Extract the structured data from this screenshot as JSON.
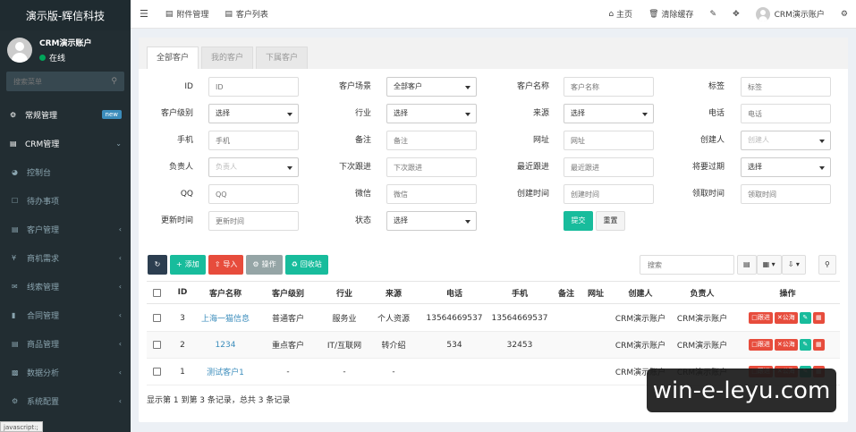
{
  "sidebar": {
    "logo": "演示版-辉信科技",
    "user": {
      "name": "CRM演示账户",
      "status": "在线"
    },
    "search_placeholder": "搜索菜单",
    "items": [
      {
        "label": "常规管理",
        "icon": "cogs-icon",
        "badge": "new"
      },
      {
        "label": "CRM管理",
        "icon": "crm-icon"
      },
      {
        "label": "控制台",
        "icon": "dashboard-icon"
      },
      {
        "label": "待办事项",
        "icon": "todo-icon"
      },
      {
        "label": "客户管理",
        "icon": "customer-icon"
      },
      {
        "label": "商机需求",
        "icon": "yen-icon"
      },
      {
        "label": "线索管理",
        "icon": "clue-icon"
      },
      {
        "label": "合同管理",
        "icon": "bookmark-icon"
      },
      {
        "label": "商品管理",
        "icon": "product-icon"
      },
      {
        "label": "数据分析",
        "icon": "chart-icon"
      },
      {
        "label": "系统配置",
        "icon": "gears-icon"
      }
    ]
  },
  "status_bar": "javascript:;",
  "topnav": {
    "tabs": [
      {
        "label": "附件管理",
        "icon": "file-icon"
      },
      {
        "label": "客户列表",
        "icon": "list-icon"
      }
    ],
    "home": "主页",
    "clear_cache": "清除缓存",
    "user": "CRM演示账户"
  },
  "content": {
    "tabs": [
      "全部客户",
      "我的客户",
      "下属客户"
    ],
    "form": {
      "row1": [
        {
          "label": "ID",
          "placeholder": "ID"
        },
        {
          "label": "客户场景",
          "value": "全部客户"
        },
        {
          "label": "客户名称",
          "placeholder": "客户名称"
        },
        {
          "label": "标签",
          "placeholder": "标签"
        }
      ],
      "row2": [
        {
          "label": "客户级别",
          "value": "选择"
        },
        {
          "label": "行业",
          "value": "选择"
        },
        {
          "label": "来源",
          "value": "选择"
        },
        {
          "label": "电话",
          "placeholder": "电话"
        }
      ],
      "row3": [
        {
          "label": "手机",
          "placeholder": "手机"
        },
        {
          "label": "备注",
          "placeholder": "备注"
        },
        {
          "label": "网址",
          "placeholder": "网址"
        },
        {
          "label": "创建人",
          "value": "创建人"
        }
      ],
      "row4": [
        {
          "label": "负责人",
          "value": "负责人"
        },
        {
          "label": "下次跟进",
          "placeholder": "下次跟进"
        },
        {
          "label": "最近跟进",
          "placeholder": "最近跟进"
        },
        {
          "label": "将要过期",
          "value": "选择"
        }
      ],
      "row5": [
        {
          "label": "QQ",
          "placeholder": "QQ"
        },
        {
          "label": "微信",
          "placeholder": "微信"
        },
        {
          "label": "创建时间",
          "placeholder": "创建时间"
        },
        {
          "label": "领取时间",
          "placeholder": "领取时间"
        }
      ],
      "row6": [
        {
          "label": "更新时间",
          "placeholder": "更新时间"
        },
        {
          "label": "状态",
          "value": "选择"
        }
      ],
      "submit": "提交",
      "reset": "重置"
    },
    "toolbar": {
      "add": "添加",
      "import": "导入",
      "operate": "操作",
      "recycle": "回收站",
      "search_placeholder": "搜索"
    },
    "table": {
      "columns": [
        "ID",
        "客户名称",
        "客户级别",
        "行业",
        "来源",
        "电话",
        "手机",
        "备注",
        "网址",
        "创建人",
        "负责人",
        "操作"
      ],
      "rows": [
        {
          "id": "3",
          "name": "上海一猫信息",
          "level": "普通客户",
          "industry": "服务业",
          "source": "个人资源",
          "phone": "13564669537",
          "mobile": "13564669537",
          "remark": "",
          "url": "",
          "creator": "CRM演示账户",
          "owner": "CRM演示账户"
        },
        {
          "id": "2",
          "name": "1234",
          "level": "重点客户",
          "industry": "IT/互联网",
          "source": "转介绍",
          "phone": "534",
          "mobile": "32453",
          "remark": "",
          "url": "",
          "creator": "CRM演示账户",
          "owner": "CRM演示账户"
        },
        {
          "id": "1",
          "name": "测试客户1",
          "level": "-",
          "industry": "-",
          "source": "-",
          "phone": "",
          "mobile": "",
          "remark": "",
          "url": "",
          "creator": "CRM演示账户",
          "owner": "CRM演示账户"
        }
      ],
      "actions": {
        "follow": "跟进",
        "public": "公海"
      }
    },
    "pager_info": "显示第 1 到第 3 条记录，总共 3 条记录"
  },
  "watermark": "win-e-leyu.com"
}
